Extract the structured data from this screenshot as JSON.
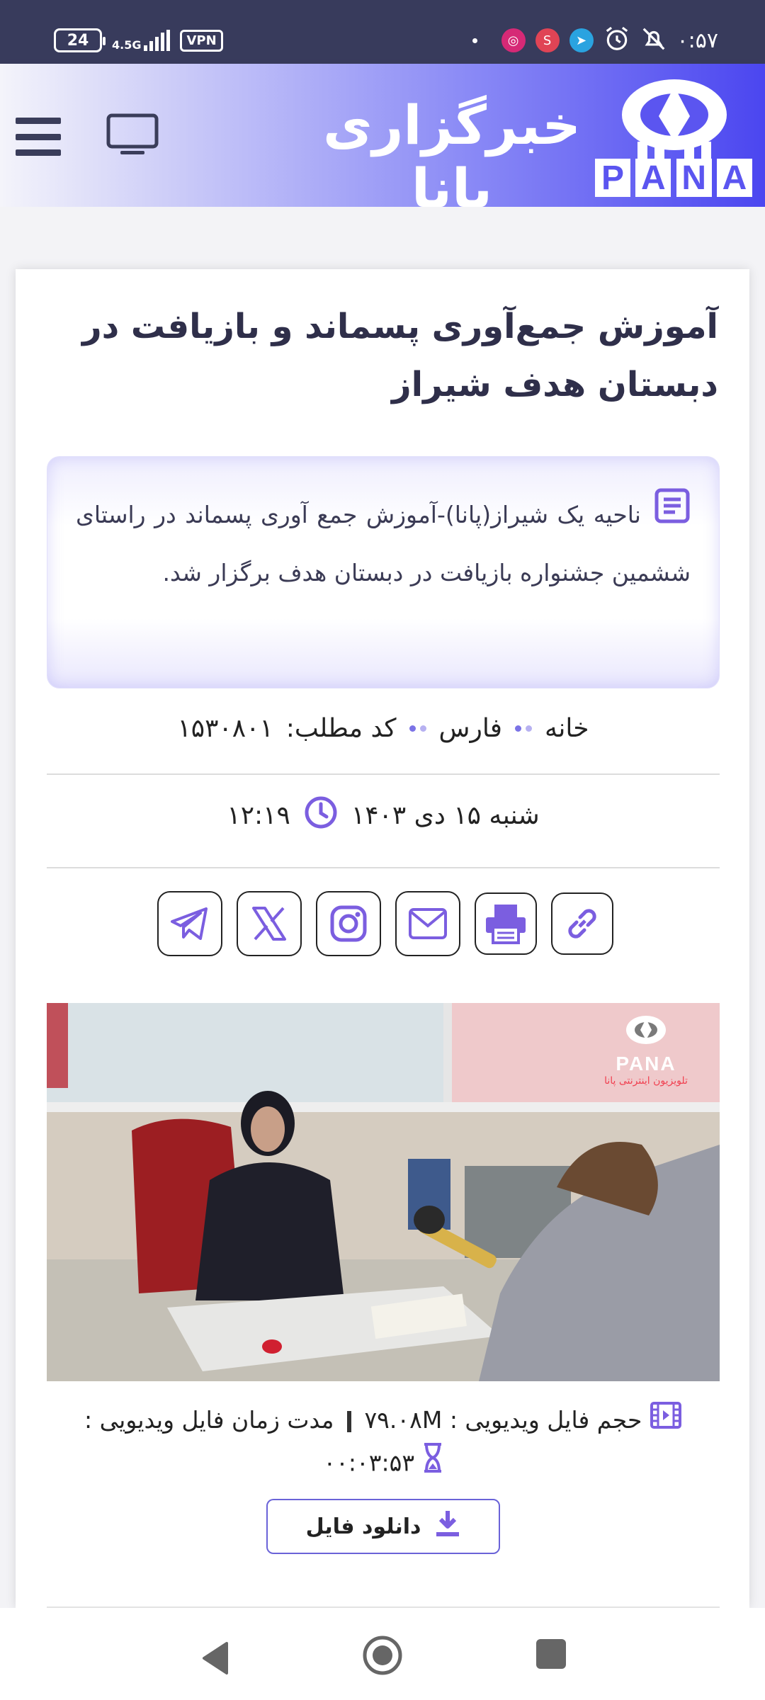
{
  "status_bar": {
    "battery": "24",
    "network": "4.5G",
    "vpn": "VPN",
    "time": "۰:۵۷"
  },
  "header": {
    "brand_text": "خبرگزاری پانا",
    "logo_letters": [
      "P",
      "A",
      "N",
      "A"
    ]
  },
  "article": {
    "title": "آموزش جمع‌آوری پسماند و بازیافت در دبستان هدف شیراز",
    "lead": "ناحیه یک شیراز(پانا)-آموزش جمع آوری پسماند در راستای ششمین جشنواره بازیافت در دبستان هدف برگزار شد.",
    "breadcrumb": {
      "home": "خانه",
      "category": "فارس",
      "code_label": "کد مطلب:",
      "code": "۱۵۳۰۸۰۱"
    },
    "date": "شنبه ۱۵ دی ۱۴۰۳",
    "time": "۱۲:۱۹"
  },
  "share": {
    "items": [
      "link-icon",
      "print-icon",
      "email-icon",
      "instagram-icon",
      "x-icon",
      "telegram-icon"
    ]
  },
  "video": {
    "watermark": "PANA",
    "watermark_sub": "تلویزیون اینترنتی پانا",
    "size_label": "حجم فایل ویدیویی :",
    "size_value": "۷۹.۰۸M",
    "duration_label": "مدت زمان فایل ویدیویی :",
    "duration_value": "۰۰:۰۳:۵۳",
    "download_label": "دانلود فایل"
  },
  "colors": {
    "accent": "#7b5ee0",
    "header_end": "#4b46f0",
    "status_bar": "#383b5c"
  }
}
